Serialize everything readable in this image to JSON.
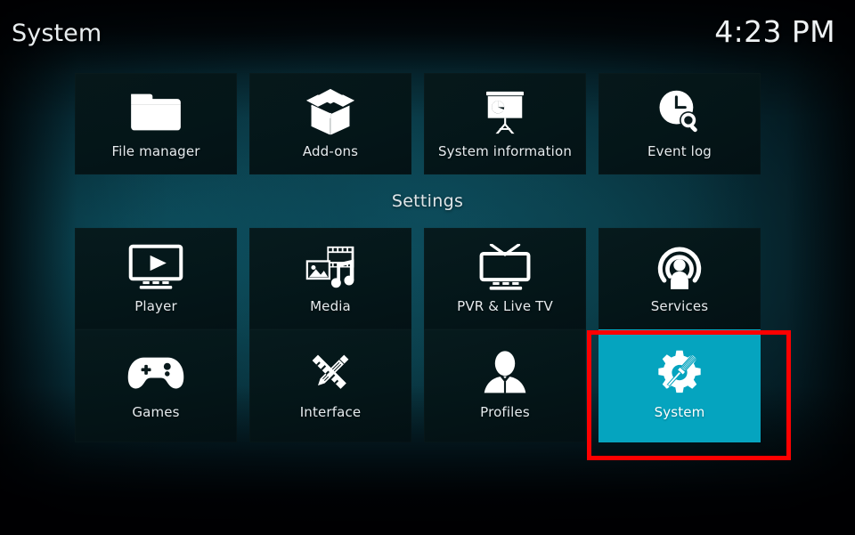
{
  "header": {
    "title": "System",
    "clock": "4:23 PM"
  },
  "colors": {
    "highlight": "#05a4bf",
    "annotation": "#fe0000",
    "tile_background": "#061719",
    "text": "#e6ebee",
    "background_teal": "#0d4452"
  },
  "sections": [
    {
      "label": "",
      "name": "top-utilities-row",
      "tiles": [
        {
          "label": "File manager",
          "icon": "folder-icon",
          "selected": false
        },
        {
          "label": "Add-ons",
          "icon": "open-box-icon",
          "selected": false
        },
        {
          "label": "System information",
          "icon": "presentation-chart-icon",
          "selected": false
        },
        {
          "label": "Event log",
          "icon": "clock-search-icon",
          "selected": false
        }
      ]
    },
    {
      "label": "Settings",
      "name": "settings-row-1",
      "tiles": [
        {
          "label": "Player",
          "icon": "monitor-play-icon",
          "selected": false
        },
        {
          "label": "Media",
          "icon": "media-library-icon",
          "selected": false
        },
        {
          "label": "PVR & Live TV",
          "icon": "tv-antenna-icon",
          "selected": false
        },
        {
          "label": "Services",
          "icon": "broadcast-user-icon",
          "selected": false
        }
      ]
    },
    {
      "label": "",
      "name": "settings-row-2",
      "tiles": [
        {
          "label": "Games",
          "icon": "gamepad-icon",
          "selected": false
        },
        {
          "label": "Interface",
          "icon": "pencil-ruler-icon",
          "selected": false
        },
        {
          "label": "Profiles",
          "icon": "user-profile-icon",
          "selected": false
        },
        {
          "label": "System",
          "icon": "gear-screwdriver-icon",
          "selected": true
        }
      ]
    }
  ],
  "annotation": {
    "target": "System",
    "shape": "rectangle",
    "color": "#fe0000"
  }
}
